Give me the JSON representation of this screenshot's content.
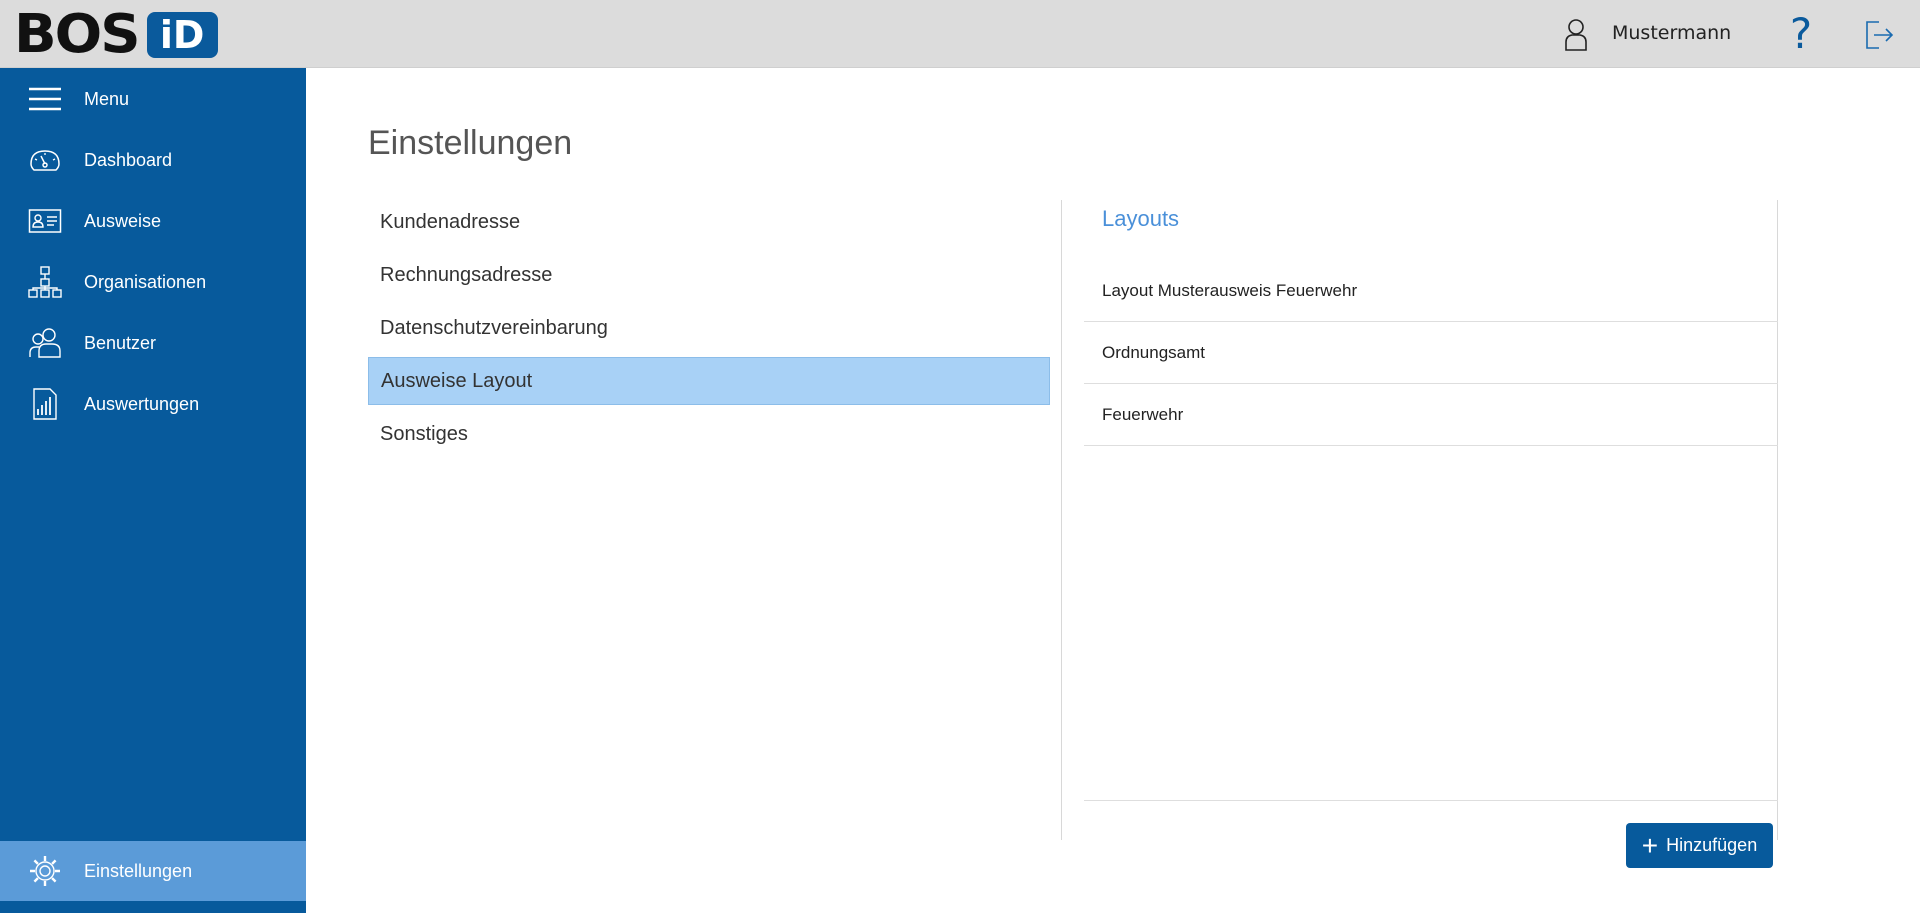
{
  "header": {
    "logo_text": "BOS",
    "logo_badge": "iD",
    "user_name": "Mustermann",
    "help_symbol": "?"
  },
  "sidebar": {
    "items": [
      {
        "label": "Menu",
        "icon": "hamburger-icon"
      },
      {
        "label": "Dashboard",
        "icon": "gauge-icon"
      },
      {
        "label": "Ausweise",
        "icon": "id-card-icon"
      },
      {
        "label": "Organisationen",
        "icon": "org-chart-icon"
      },
      {
        "label": "Benutzer",
        "icon": "users-icon"
      },
      {
        "label": "Auswertungen",
        "icon": "report-chart-icon"
      }
    ],
    "bottom_item": {
      "label": "Einstellungen",
      "icon": "gear-icon"
    }
  },
  "main": {
    "title": "Einstellungen",
    "settings": [
      {
        "label": "Kundenadresse",
        "active": false
      },
      {
        "label": "Rechnungsadresse",
        "active": false
      },
      {
        "label": "Datenschutzvereinbarung",
        "active": false
      },
      {
        "label": "Ausweise Layout",
        "active": true
      },
      {
        "label": "Sonstiges",
        "active": false
      }
    ],
    "panel": {
      "title": "Layouts",
      "items": [
        "Layout Musterausweis Feuerwehr",
        "Ordnungsamt",
        "Feuerwehr"
      ],
      "add_button_label": "Hinzufügen",
      "add_button_symbol": "+"
    }
  },
  "colors": {
    "brand_blue": "#075a9c",
    "active_nav": "#5b9bd8",
    "active_setting": "#a8d1f6",
    "panel_title": "#4a90d9"
  }
}
